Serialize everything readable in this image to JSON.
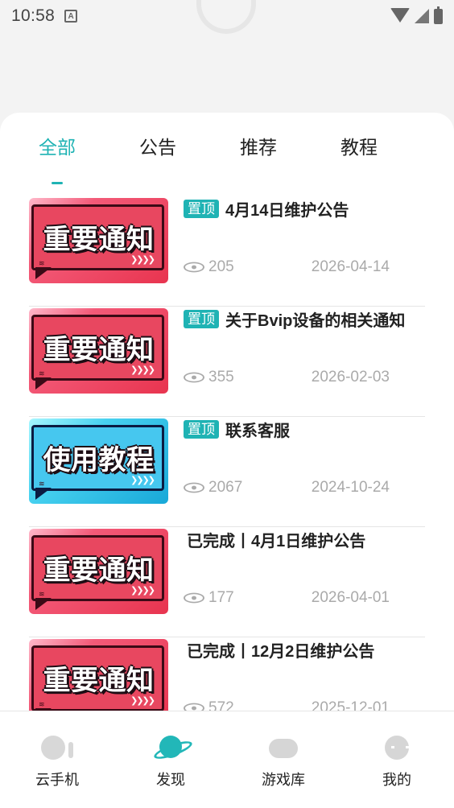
{
  "status_bar": {
    "time": "10:58",
    "a_badge": "A"
  },
  "tabs": [
    {
      "label": "全部",
      "active": true
    },
    {
      "label": "公告",
      "active": false
    },
    {
      "label": "推荐",
      "active": false
    },
    {
      "label": "教程",
      "active": false
    }
  ],
  "items": [
    {
      "thumb_text": "重要通知",
      "thumb_color": "#e84760",
      "pinned": true,
      "pin_label": "置顶",
      "title": "4月14日维护公告",
      "views": "205",
      "date": "2026-04-14"
    },
    {
      "thumb_text": "重要通知",
      "thumb_color": "#e84760",
      "pinned": true,
      "pin_label": "置顶",
      "title": "关于Bvip设备的相关通知",
      "views": "355",
      "date": "2026-02-03"
    },
    {
      "thumb_text": "使用教程",
      "thumb_color": "#46c7ef",
      "pinned": true,
      "pin_label": "置顶",
      "title": "联系客服",
      "views": "2067",
      "date": "2024-10-24"
    },
    {
      "thumb_text": "重要通知",
      "thumb_color": "#e84760",
      "pinned": false,
      "title": "已完成丨4月1日维护公告",
      "views": "177",
      "date": "2026-04-01"
    },
    {
      "thumb_text": "重要通知",
      "thumb_color": "#e84760",
      "pinned": false,
      "title": "已完成丨12月2日维护公告",
      "views": "572",
      "date": "2025-12-01"
    }
  ],
  "bottom_nav": [
    {
      "label": "云手机",
      "icon": "cloud-phone-icon",
      "active": false
    },
    {
      "label": "发现",
      "icon": "planet-icon",
      "active": true
    },
    {
      "label": "游戏库",
      "icon": "gamepad-icon",
      "active": false
    },
    {
      "label": "我的",
      "icon": "profile-icon",
      "active": false
    }
  ],
  "colors": {
    "accent": "#1fb3b4",
    "notice_red": "#e84760",
    "tutorial_blue": "#46c7ef"
  }
}
